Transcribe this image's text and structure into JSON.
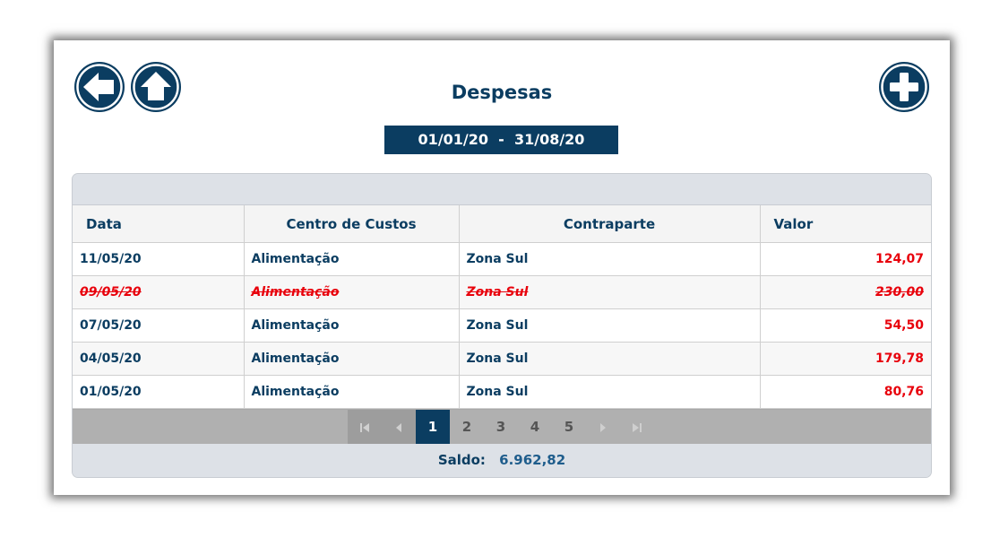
{
  "header": {
    "title": "Despesas",
    "date_range": "01/01/20  -  31/08/20"
  },
  "buttons": {
    "back_icon": "arrow-left-icon",
    "home_icon": "arrow-up-icon",
    "add_icon": "plus-icon"
  },
  "table": {
    "columns": [
      "Data",
      "Centro de Custos",
      "Contraparte",
      "Valor"
    ],
    "rows": [
      {
        "data": "11/05/20",
        "centro": "Alimentação",
        "contraparte": "Zona Sul",
        "valor": "124,07",
        "struck": false
      },
      {
        "data": "09/05/20",
        "centro": "Alimentação",
        "contraparte": "Zona Sul",
        "valor": "230,00",
        "struck": true
      },
      {
        "data": "07/05/20",
        "centro": "Alimentação",
        "contraparte": "Zona Sul",
        "valor": "54,50",
        "struck": false
      },
      {
        "data": "04/05/20",
        "centro": "Alimentação",
        "contraparte": "Zona Sul",
        "valor": "179,78",
        "struck": false
      },
      {
        "data": "01/05/20",
        "centro": "Alimentação",
        "contraparte": "Zona Sul",
        "valor": "80,76",
        "struck": false
      }
    ]
  },
  "pager": {
    "pages": [
      "1",
      "2",
      "3",
      "4",
      "5"
    ],
    "current": "1"
  },
  "footer": {
    "saldo_label": "Saldo:",
    "saldo_value": "6.962,82"
  },
  "colors": {
    "primary": "#0b3d61",
    "negative": "#e8000b",
    "grid_bg": "#dde1e7"
  }
}
